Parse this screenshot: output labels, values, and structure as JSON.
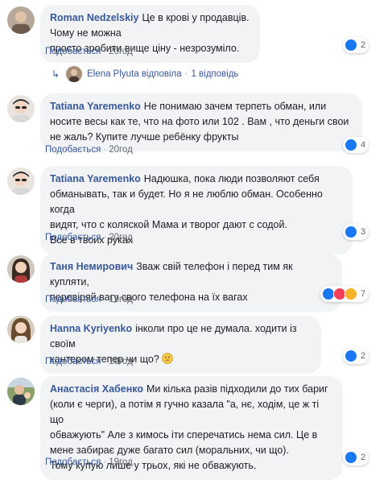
{
  "comments": [
    {
      "author": "Roman Nedzelskiy",
      "text_lines": [
        "Це в крові у продавців. Чому не можна",
        "просто зробити вище ціну - незрозуміло."
      ],
      "like_label": "Подобається",
      "time": "20год",
      "reaction_count": "2"
    },
    {
      "author": "Tatiana Yaremenko",
      "text_lines": [
        "Не понимаю зачем терпеть обман, или",
        "носите весы как те, что на фото или 102 . Вам , что деньги свои",
        "не жаль? Купите лучше ребёнку фрукты"
      ],
      "like_label": "Подобається",
      "time": "20год",
      "reaction_count": "4"
    },
    {
      "author": "Tatiana Yaremenko",
      "text_lines": [
        "Надюшка, пока люди позволяют себя",
        "обманывать, так и будет. Но я не люблю обман. Особенно когда",
        "видят, что с коляской Мама и творог дают с содой.",
        "Все в твоих руках"
      ],
      "like_label": "Подобається",
      "time": "20год",
      "reaction_count": "3"
    },
    {
      "author": "Таня Немирович",
      "text_lines": [
        "Зваж свій телефон і перед тим як купляти,",
        "перевіряй вагу свого телефона на їх вагах"
      ],
      "like_label": "Подобається",
      "time": "19год",
      "reaction_count": "7"
    },
    {
      "author": "Hanna Kyriyenko",
      "text_lines": [
        "інколи про це не думала. ходити із своїм",
        "кантером тепер чи що?"
      ],
      "like_label": "Подобається",
      "time": "19год",
      "reaction_count": "2"
    },
    {
      "author": "Анастасія Хабенко",
      "text_lines": [
        "Ми кілька разів підходили до тих бариг",
        "(коли є черги), а потім я гучно казала \"а, нє, ходім, це ж ті що",
        "обважують\"  Але з кимось іти сперечатись нема сил. Це в",
        "мене забирає дуже багато сил (моральних, чи що).",
        "Тому купую лише у трьох, які не обважують."
      ],
      "like_label": "Подобається",
      "time": "19год",
      "reaction_count": "2"
    }
  ],
  "reply": {
    "author": "Elena Plyuta",
    "action": "відповіла",
    "count_text": "1 відповідь"
  },
  "colors": {
    "link": "#385898",
    "bubble": "#f2f3f5",
    "like_blue": "#1877f2",
    "love_red": "#f33e58",
    "wow_yellow": "#f7b125"
  }
}
